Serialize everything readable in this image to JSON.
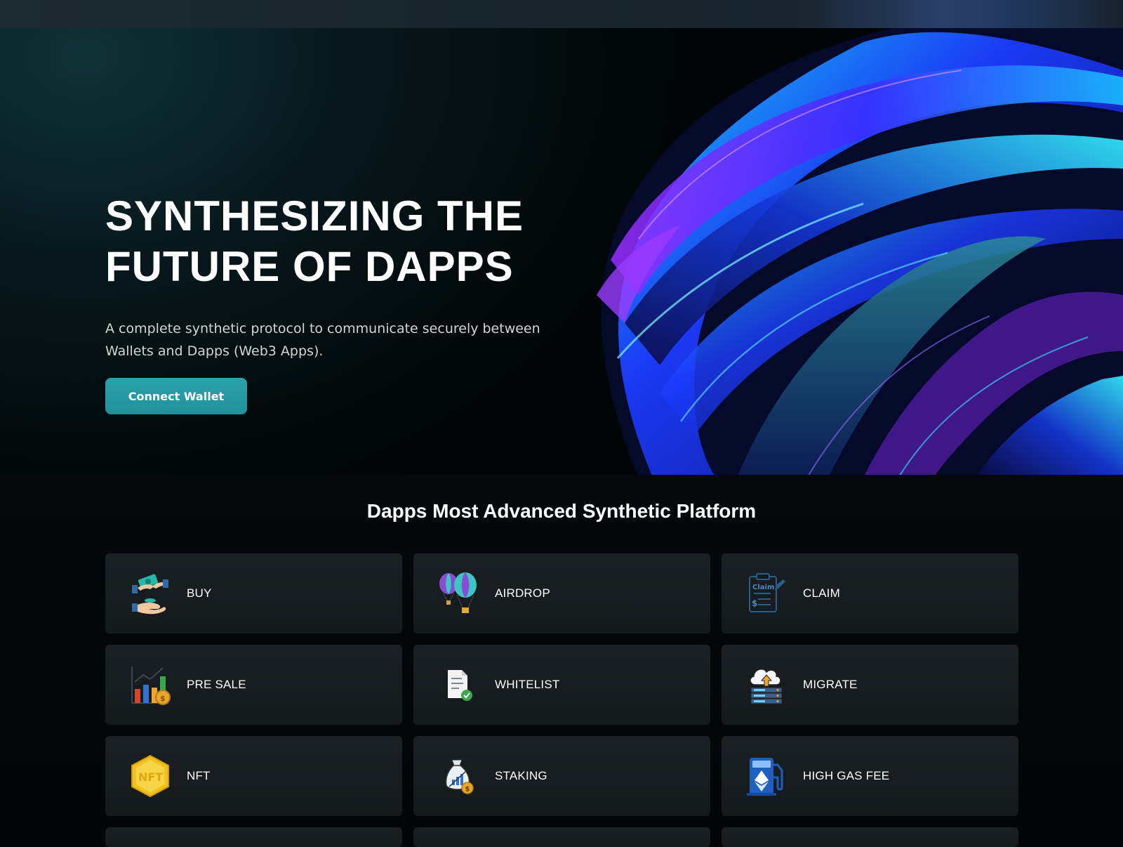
{
  "hero": {
    "title": "SYNTHESIZING THE\nFUTURE OF DAPPS",
    "subtitle": "A complete synthetic protocol to communicate securely between Wallets and Dapps (Web3 Apps).",
    "connect_label": "Connect Wallet"
  },
  "platform": {
    "title": "Dapps Most Advanced Synthetic Platform",
    "items": [
      {
        "label": "BUY",
        "icon": "handshake-money-icon"
      },
      {
        "label": "AIRDROP",
        "icon": "balloons-icon"
      },
      {
        "label": "CLAIM",
        "icon": "claim-clipboard-icon"
      },
      {
        "label": "PRE SALE",
        "icon": "bar-chart-coin-icon"
      },
      {
        "label": "WHITELIST",
        "icon": "document-check-icon"
      },
      {
        "label": "MIGRATE",
        "icon": "cloud-upload-server-icon"
      },
      {
        "label": "NFT",
        "icon": "nft-hexagon-icon"
      },
      {
        "label": "STAKING",
        "icon": "money-bag-chart-icon"
      },
      {
        "label": "HIGH GAS FEE",
        "icon": "ethereum-gas-pump-icon"
      }
    ]
  },
  "colors": {
    "accent": "#2aa3ad",
    "card_bg": "#181e21",
    "page_bg": "#020608"
  }
}
